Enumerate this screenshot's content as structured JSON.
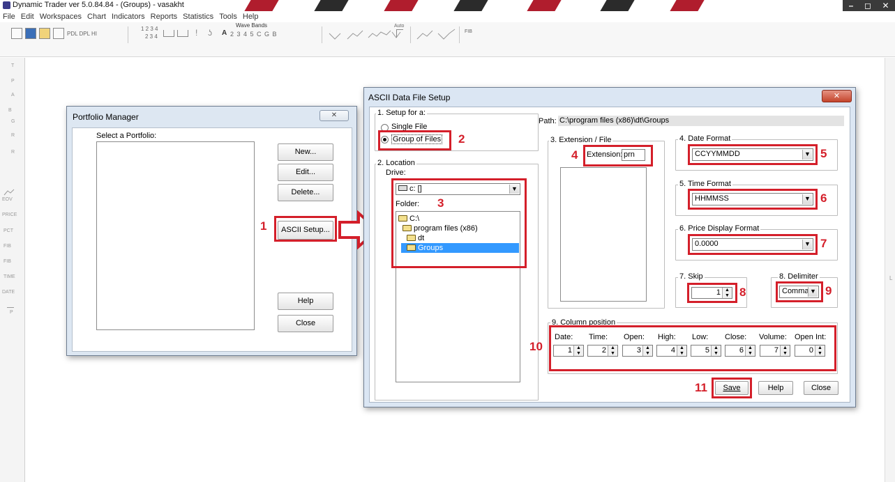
{
  "app": {
    "title": "Dynamic Trader ver 5.0.84.84 - (Groups) - vasakht",
    "menu": [
      "File",
      "Edit",
      "Workspaces",
      "Chart",
      "Indicators",
      "Reports",
      "Statistics",
      "Tools",
      "Help"
    ],
    "toolbar": {
      "pdl_dpl_hi": "PDL DPL HI",
      "nums_top": "1 2 3 4",
      "nums_bottom": "2 3 4",
      "wave_bands_title": "Wave Bands",
      "wave_bands_letters": "2 3 4 5 C G B",
      "auto_label": "Auto",
      "fib_label": "FIB",
      "letter_a": "A"
    },
    "left_tools": [
      "T",
      "P",
      "A",
      "B",
      "G",
      "R",
      "R",
      "EOV",
      "PRICE",
      "PCT",
      "FIB",
      "FIB",
      "TIME",
      "DATE",
      "P"
    ],
    "right_tools": [
      "L"
    ]
  },
  "portfolio_manager": {
    "title": "Portfolio Manager",
    "select_label": "Select a Portfolio:",
    "buttons": {
      "new": "New...",
      "edit": "Edit...",
      "delete": "Delete...",
      "ascii_setup": "ASCII Setup...",
      "help": "Help",
      "close": "Close"
    }
  },
  "ascii_dialog": {
    "title": "ASCII Data File Setup",
    "setup_for": {
      "label": "1. Setup for a:",
      "single_file": "Single File",
      "group_of_files": "Group of Files",
      "selected": "Group of Files"
    },
    "path": {
      "label": "Path:",
      "value": "C:\\program files (x86)\\dt\\Groups"
    },
    "location": {
      "label": "2. Location",
      "drive_label": "Drive:",
      "drive_value": "c: []",
      "folder_label": "Folder:",
      "folders": [
        "C:\\",
        "program files (x86)",
        "dt",
        "Groups"
      ],
      "selected_folder": "Groups"
    },
    "extension": {
      "group_label": "3. Extension / File",
      "label": "Extension:",
      "value": "prn"
    },
    "date_format": {
      "label": "4. Date Format",
      "value": "CCYYMMDD"
    },
    "time_format": {
      "label": "5. Time Format",
      "value": "HHMMSS"
    },
    "price_display_format": {
      "label": "6. Price Display Format",
      "value": "0.0000"
    },
    "skip": {
      "label": "7. Skip",
      "value": "1"
    },
    "delimiter": {
      "label": "8. Delimiter",
      "value": "Comma"
    },
    "column_position": {
      "label": "9. Column position",
      "columns": [
        {
          "name": "Date:",
          "value": "1"
        },
        {
          "name": "Time:",
          "value": "2"
        },
        {
          "name": "Open:",
          "value": "3"
        },
        {
          "name": "High:",
          "value": "4"
        },
        {
          "name": "Low:",
          "value": "5"
        },
        {
          "name": "Close:",
          "value": "6"
        },
        {
          "name": "Volume:",
          "value": "7"
        },
        {
          "name": "Open Int:",
          "value": "0"
        }
      ]
    },
    "buttons": {
      "save": "Save",
      "help": "Help",
      "close": "Close"
    }
  },
  "annotations": {
    "n1": "1",
    "n2": "2",
    "n3": "3",
    "n4": "4",
    "n5": "5",
    "n6": "6",
    "n7": "7",
    "n8": "8",
    "n9": "9",
    "n10": "10",
    "n11": "11"
  },
  "colors": {
    "highlight": "#d41f2a",
    "selection": "#3399ff",
    "dialog_frame": "#dbe6f3",
    "close_button": "#c4452c"
  }
}
